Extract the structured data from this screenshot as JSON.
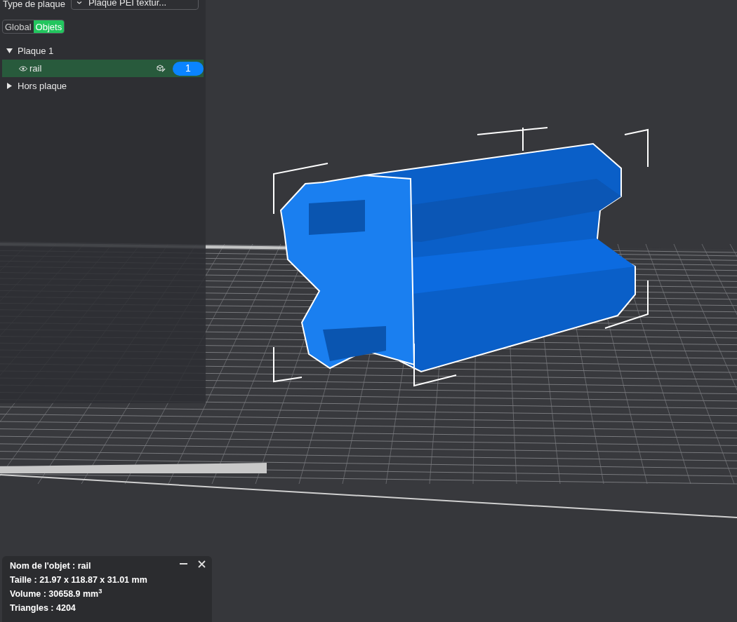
{
  "plate_type": {
    "label": "Type de plaque",
    "value": "Plaque PEI textur..."
  },
  "view_tabs": [
    {
      "label": "Global",
      "selected": false
    },
    {
      "label": "Objets",
      "selected": true
    }
  ],
  "object_tree": [
    {
      "label": "Plaque 1",
      "expanded": true,
      "selected": false,
      "children": [
        {
          "label": "rail",
          "selected": true,
          "badge": "1"
        }
      ]
    },
    {
      "label": "Hors plaque",
      "expanded": false,
      "selected": false
    }
  ],
  "info_panel": {
    "lines": [
      "Nom de l'objet : rail",
      "Taille : 21.97 x 118.87 x 31.01 mm",
      "Volume : 30658.9 mm$^{3}$",
      "Triangles : 4204"
    ]
  }
}
